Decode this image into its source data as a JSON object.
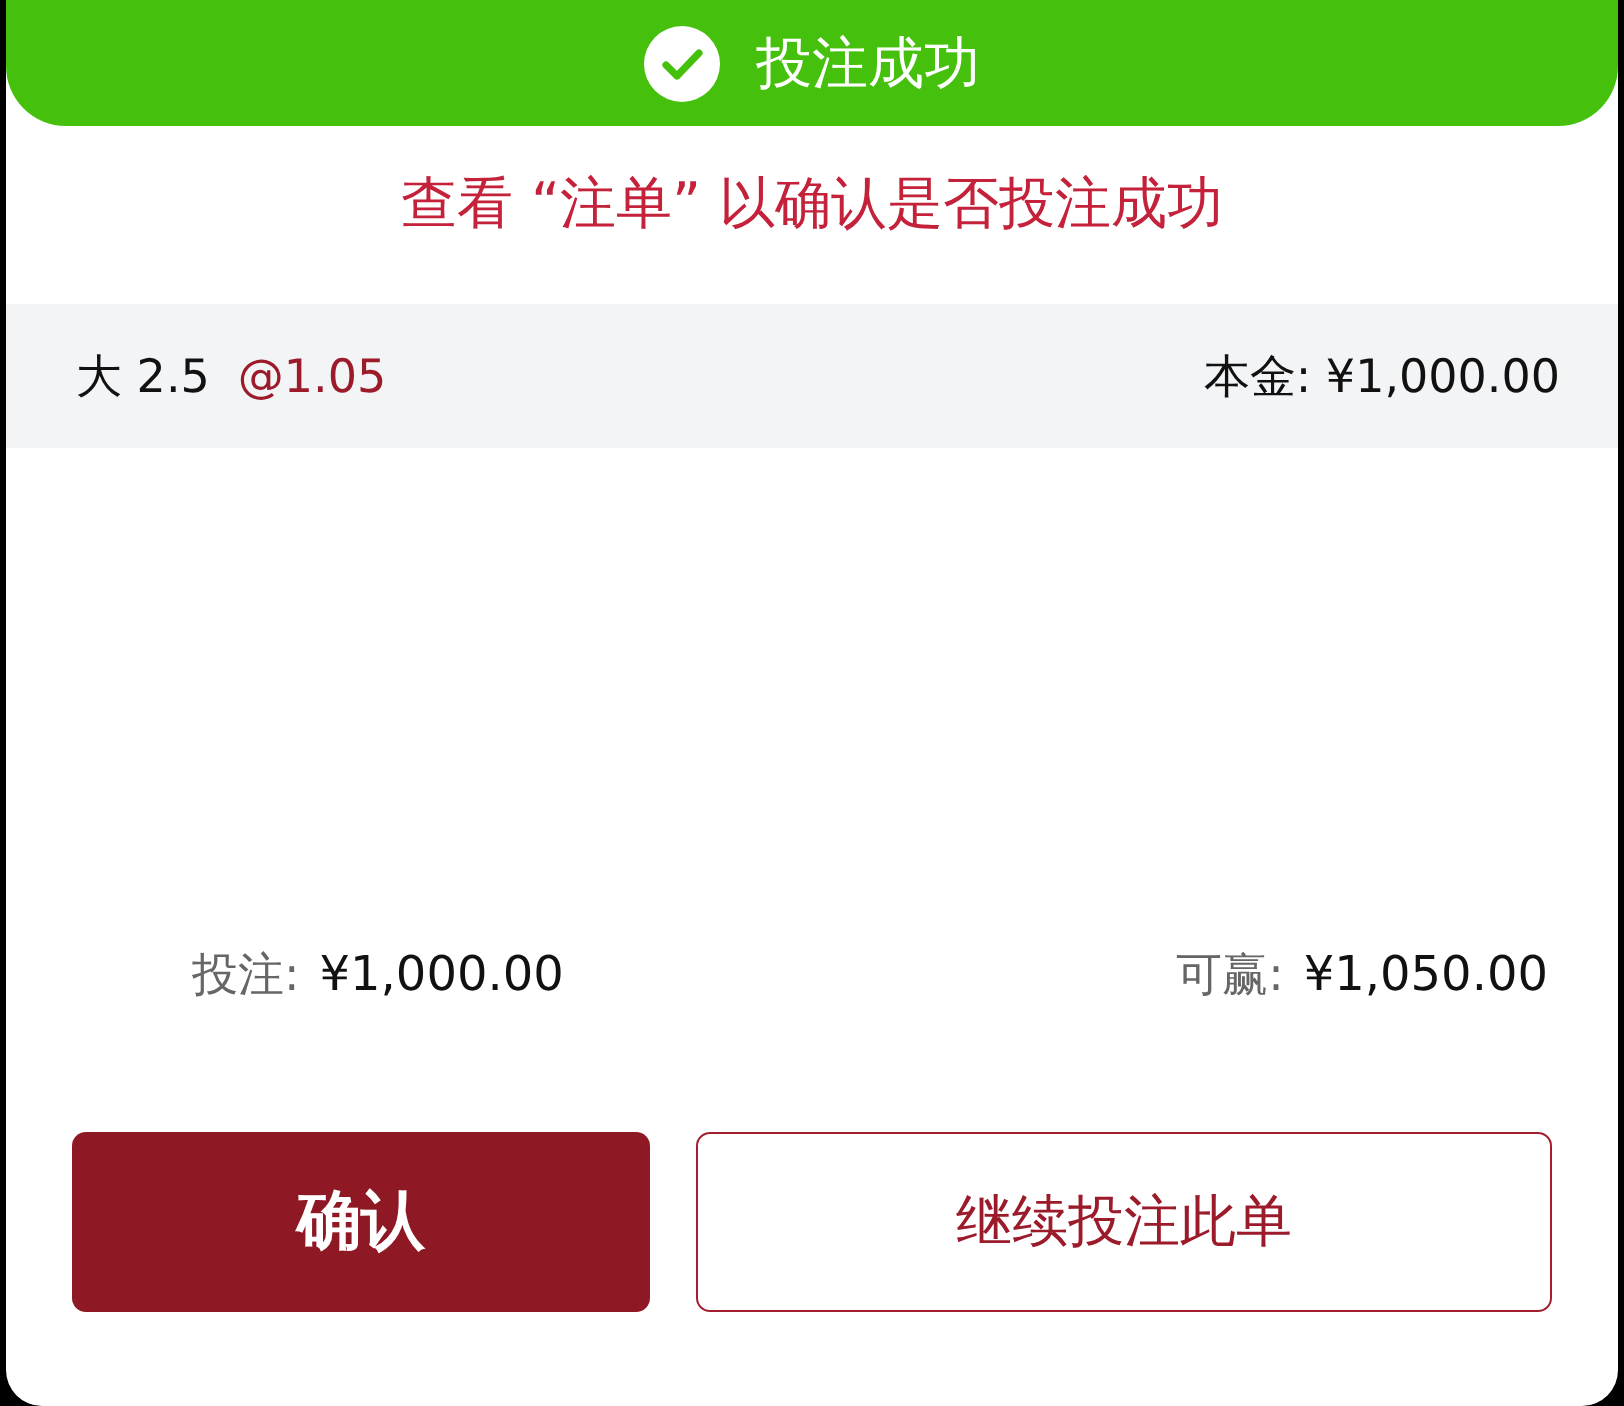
{
  "toast": {
    "title": "投注成功"
  },
  "notice": "查看 “注单” 以确认是否投注成功",
  "selection": {
    "pick": "大 2.5",
    "odds": "@1.05",
    "principal": "本金: ¥1,000.00"
  },
  "totals": [
    {
      "label": "投注:",
      "value": "¥1,000.00"
    },
    {
      "label": "可赢:",
      "value": "¥1,050.00"
    }
  ],
  "buttons": [
    {
      "label": "确认",
      "kind": "primary"
    },
    {
      "label": "继续投注此单",
      "kind": "outline"
    }
  ]
}
